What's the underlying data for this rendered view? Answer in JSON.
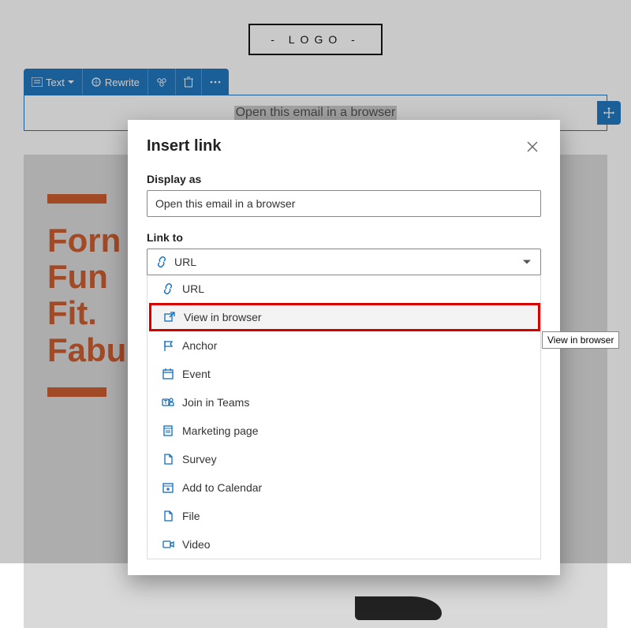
{
  "editor": {
    "logo_text": "- LOGO -",
    "toolbar": {
      "text_label": "Text",
      "rewrite_label": "Rewrite"
    },
    "selected_text": "Open this email in a browser",
    "hero_lines": [
      "Forn",
      "Fun",
      "Fit.",
      "Fabu"
    ]
  },
  "dialog": {
    "title": "Insert link",
    "field_display_label": "Display as",
    "display_value": "Open this email in a browser",
    "field_linkto_label": "Link to",
    "selected_option": "URL",
    "options": [
      {
        "icon": "link",
        "label": "URL"
      },
      {
        "icon": "external",
        "label": "View in browser"
      },
      {
        "icon": "flag",
        "label": "Anchor"
      },
      {
        "icon": "calendar",
        "label": "Event"
      },
      {
        "icon": "teams",
        "label": "Join in Teams"
      },
      {
        "icon": "page",
        "label": "Marketing page"
      },
      {
        "icon": "doc",
        "label": "Survey"
      },
      {
        "icon": "cal-add",
        "label": "Add to Calendar"
      },
      {
        "icon": "file",
        "label": "File"
      },
      {
        "icon": "video",
        "label": "Video"
      }
    ]
  },
  "tooltip": "View in browser"
}
